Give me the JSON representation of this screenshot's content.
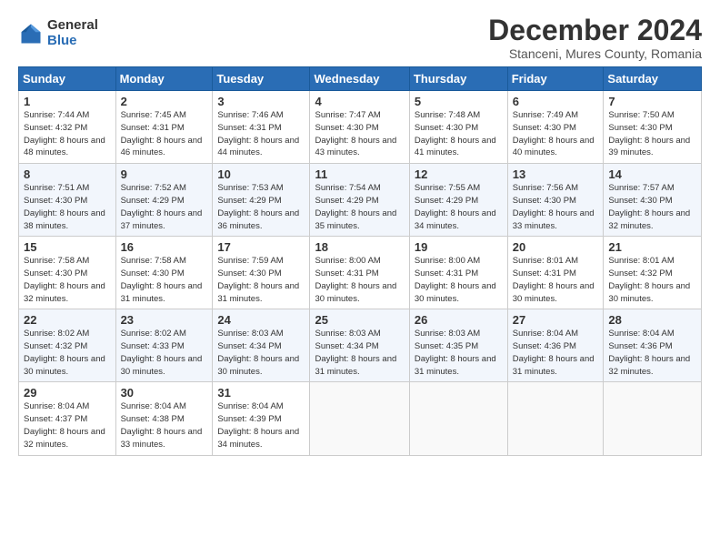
{
  "logo": {
    "general": "General",
    "blue": "Blue"
  },
  "header": {
    "month": "December 2024",
    "location": "Stanceni, Mures County, Romania"
  },
  "weekdays": [
    "Sunday",
    "Monday",
    "Tuesday",
    "Wednesday",
    "Thursday",
    "Friday",
    "Saturday"
  ],
  "weeks": [
    [
      {
        "day": "1",
        "sunrise": "7:44 AM",
        "sunset": "4:32 PM",
        "daylight": "8 hours and 48 minutes."
      },
      {
        "day": "2",
        "sunrise": "7:45 AM",
        "sunset": "4:31 PM",
        "daylight": "8 hours and 46 minutes."
      },
      {
        "day": "3",
        "sunrise": "7:46 AM",
        "sunset": "4:31 PM",
        "daylight": "8 hours and 44 minutes."
      },
      {
        "day": "4",
        "sunrise": "7:47 AM",
        "sunset": "4:30 PM",
        "daylight": "8 hours and 43 minutes."
      },
      {
        "day": "5",
        "sunrise": "7:48 AM",
        "sunset": "4:30 PM",
        "daylight": "8 hours and 41 minutes."
      },
      {
        "day": "6",
        "sunrise": "7:49 AM",
        "sunset": "4:30 PM",
        "daylight": "8 hours and 40 minutes."
      },
      {
        "day": "7",
        "sunrise": "7:50 AM",
        "sunset": "4:30 PM",
        "daylight": "8 hours and 39 minutes."
      }
    ],
    [
      {
        "day": "8",
        "sunrise": "7:51 AM",
        "sunset": "4:30 PM",
        "daylight": "8 hours and 38 minutes."
      },
      {
        "day": "9",
        "sunrise": "7:52 AM",
        "sunset": "4:29 PM",
        "daylight": "8 hours and 37 minutes."
      },
      {
        "day": "10",
        "sunrise": "7:53 AM",
        "sunset": "4:29 PM",
        "daylight": "8 hours and 36 minutes."
      },
      {
        "day": "11",
        "sunrise": "7:54 AM",
        "sunset": "4:29 PM",
        "daylight": "8 hours and 35 minutes."
      },
      {
        "day": "12",
        "sunrise": "7:55 AM",
        "sunset": "4:29 PM",
        "daylight": "8 hours and 34 minutes."
      },
      {
        "day": "13",
        "sunrise": "7:56 AM",
        "sunset": "4:30 PM",
        "daylight": "8 hours and 33 minutes."
      },
      {
        "day": "14",
        "sunrise": "7:57 AM",
        "sunset": "4:30 PM",
        "daylight": "8 hours and 32 minutes."
      }
    ],
    [
      {
        "day": "15",
        "sunrise": "7:58 AM",
        "sunset": "4:30 PM",
        "daylight": "8 hours and 32 minutes."
      },
      {
        "day": "16",
        "sunrise": "7:58 AM",
        "sunset": "4:30 PM",
        "daylight": "8 hours and 31 minutes."
      },
      {
        "day": "17",
        "sunrise": "7:59 AM",
        "sunset": "4:30 PM",
        "daylight": "8 hours and 31 minutes."
      },
      {
        "day": "18",
        "sunrise": "8:00 AM",
        "sunset": "4:31 PM",
        "daylight": "8 hours and 30 minutes."
      },
      {
        "day": "19",
        "sunrise": "8:00 AM",
        "sunset": "4:31 PM",
        "daylight": "8 hours and 30 minutes."
      },
      {
        "day": "20",
        "sunrise": "8:01 AM",
        "sunset": "4:31 PM",
        "daylight": "8 hours and 30 minutes."
      },
      {
        "day": "21",
        "sunrise": "8:01 AM",
        "sunset": "4:32 PM",
        "daylight": "8 hours and 30 minutes."
      }
    ],
    [
      {
        "day": "22",
        "sunrise": "8:02 AM",
        "sunset": "4:32 PM",
        "daylight": "8 hours and 30 minutes."
      },
      {
        "day": "23",
        "sunrise": "8:02 AM",
        "sunset": "4:33 PM",
        "daylight": "8 hours and 30 minutes."
      },
      {
        "day": "24",
        "sunrise": "8:03 AM",
        "sunset": "4:34 PM",
        "daylight": "8 hours and 30 minutes."
      },
      {
        "day": "25",
        "sunrise": "8:03 AM",
        "sunset": "4:34 PM",
        "daylight": "8 hours and 31 minutes."
      },
      {
        "day": "26",
        "sunrise": "8:03 AM",
        "sunset": "4:35 PM",
        "daylight": "8 hours and 31 minutes."
      },
      {
        "day": "27",
        "sunrise": "8:04 AM",
        "sunset": "4:36 PM",
        "daylight": "8 hours and 31 minutes."
      },
      {
        "day": "28",
        "sunrise": "8:04 AM",
        "sunset": "4:36 PM",
        "daylight": "8 hours and 32 minutes."
      }
    ],
    [
      {
        "day": "29",
        "sunrise": "8:04 AM",
        "sunset": "4:37 PM",
        "daylight": "8 hours and 32 minutes."
      },
      {
        "day": "30",
        "sunrise": "8:04 AM",
        "sunset": "4:38 PM",
        "daylight": "8 hours and 33 minutes."
      },
      {
        "day": "31",
        "sunrise": "8:04 AM",
        "sunset": "4:39 PM",
        "daylight": "8 hours and 34 minutes."
      },
      null,
      null,
      null,
      null
    ]
  ]
}
